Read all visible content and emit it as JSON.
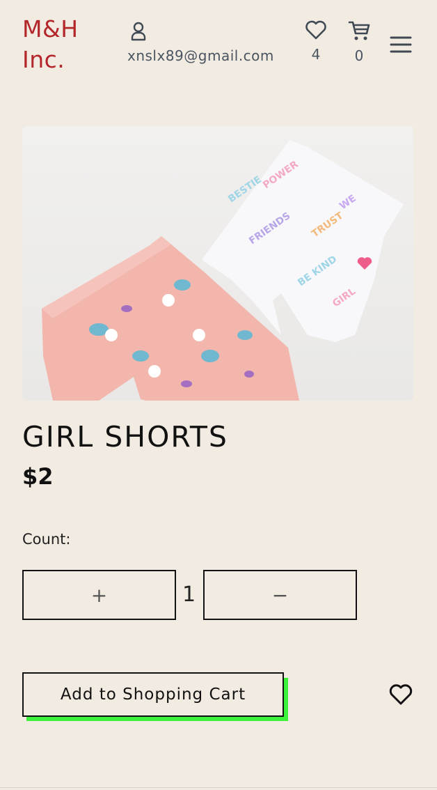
{
  "header": {
    "brand": "M&H\nInc.",
    "brand_line1": "M&H",
    "brand_line2": "Inc.",
    "account_email": "xnslx89@gmail.com",
    "wishlist_count": "4",
    "cart_count": "0",
    "icons": [
      "user-icon",
      "heart-icon",
      "cart-icon",
      "menu-icon"
    ]
  },
  "product": {
    "title": "GIRL SHORTS",
    "price": "$2",
    "image_alt_icon": "product-photo"
  },
  "quantity": {
    "label": "Count:",
    "value": "1",
    "plus_label": "+",
    "minus_label": "−"
  },
  "actions": {
    "add_to_cart_label": "Add to Shopping Cart",
    "favorite_icon": "heart-icon"
  },
  "colors": {
    "background": "#f2ebe1",
    "brand": "#b3262a",
    "cart_shadow": "#3cf23a"
  }
}
